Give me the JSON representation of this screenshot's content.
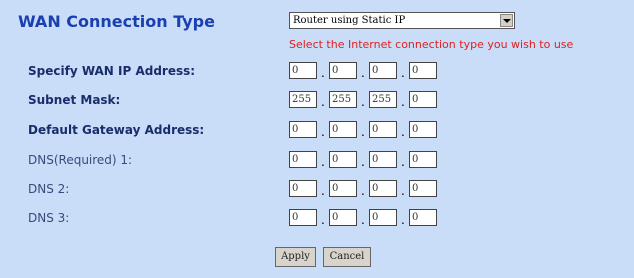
{
  "header": {
    "title": "WAN Connection Type"
  },
  "connection_select": {
    "value": "Router using Static IP"
  },
  "hint": "Select the Internet connection type you wish to use",
  "fields": [
    {
      "label": "Specify WAN IP Address:",
      "octets": [
        "0",
        "0",
        "0",
        "0"
      ]
    },
    {
      "label": "Subnet Mask:",
      "octets": [
        "255",
        "255",
        "255",
        "0"
      ]
    },
    {
      "label": "Default Gateway Address:",
      "octets": [
        "0",
        "0",
        "0",
        "0"
      ]
    },
    {
      "label": "DNS(Required)   1:",
      "octets": [
        "0",
        "0",
        "0",
        "0"
      ]
    },
    {
      "label": "DNS   2:",
      "octets": [
        "0",
        "0",
        "0",
        "0"
      ]
    },
    {
      "label": "DNS   3:",
      "octets": [
        "0",
        "0",
        "0",
        "0"
      ]
    }
  ],
  "separator": ".",
  "buttons": {
    "apply": "Apply",
    "cancel": "Cancel"
  },
  "colors": {
    "background": "#c9ddf8",
    "title": "#1a3fb0",
    "hint": "#e02020"
  }
}
